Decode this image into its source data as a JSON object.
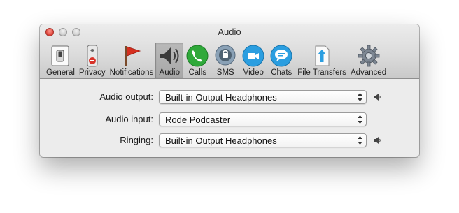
{
  "window": {
    "title": "Audio"
  },
  "toolbar": {
    "items": [
      {
        "label": "General",
        "icon": "switch-icon"
      },
      {
        "label": "Privacy",
        "icon": "privacy-sign-icon"
      },
      {
        "label": "Notifications",
        "icon": "red-flag-icon"
      },
      {
        "label": "Audio",
        "icon": "speaker-waves-icon",
        "selected": true
      },
      {
        "label": "Calls",
        "icon": "phone-icon"
      },
      {
        "label": "SMS",
        "icon": "sms-bubble-icon"
      },
      {
        "label": "Video",
        "icon": "video-camera-icon"
      },
      {
        "label": "Chats",
        "icon": "chat-bubble-icon"
      },
      {
        "label": "File Transfers",
        "icon": "upload-arrow-icon"
      },
      {
        "label": "Advanced",
        "icon": "gear-icon"
      }
    ]
  },
  "settings": {
    "audio_output": {
      "label": "Audio output:",
      "value": "Built-in Output Headphones"
    },
    "audio_input": {
      "label": "Audio input:",
      "value": "Rode Podcaster"
    },
    "ringing": {
      "label": "Ringing:",
      "value": "Built-in Output Headphones"
    }
  },
  "colors": {
    "close_button": "#e1493f",
    "selected_tab": "#afafaf",
    "calls_green": "#2fa93a",
    "video_blue": "#2b9ee0",
    "flag_red": "#d62f1f"
  }
}
